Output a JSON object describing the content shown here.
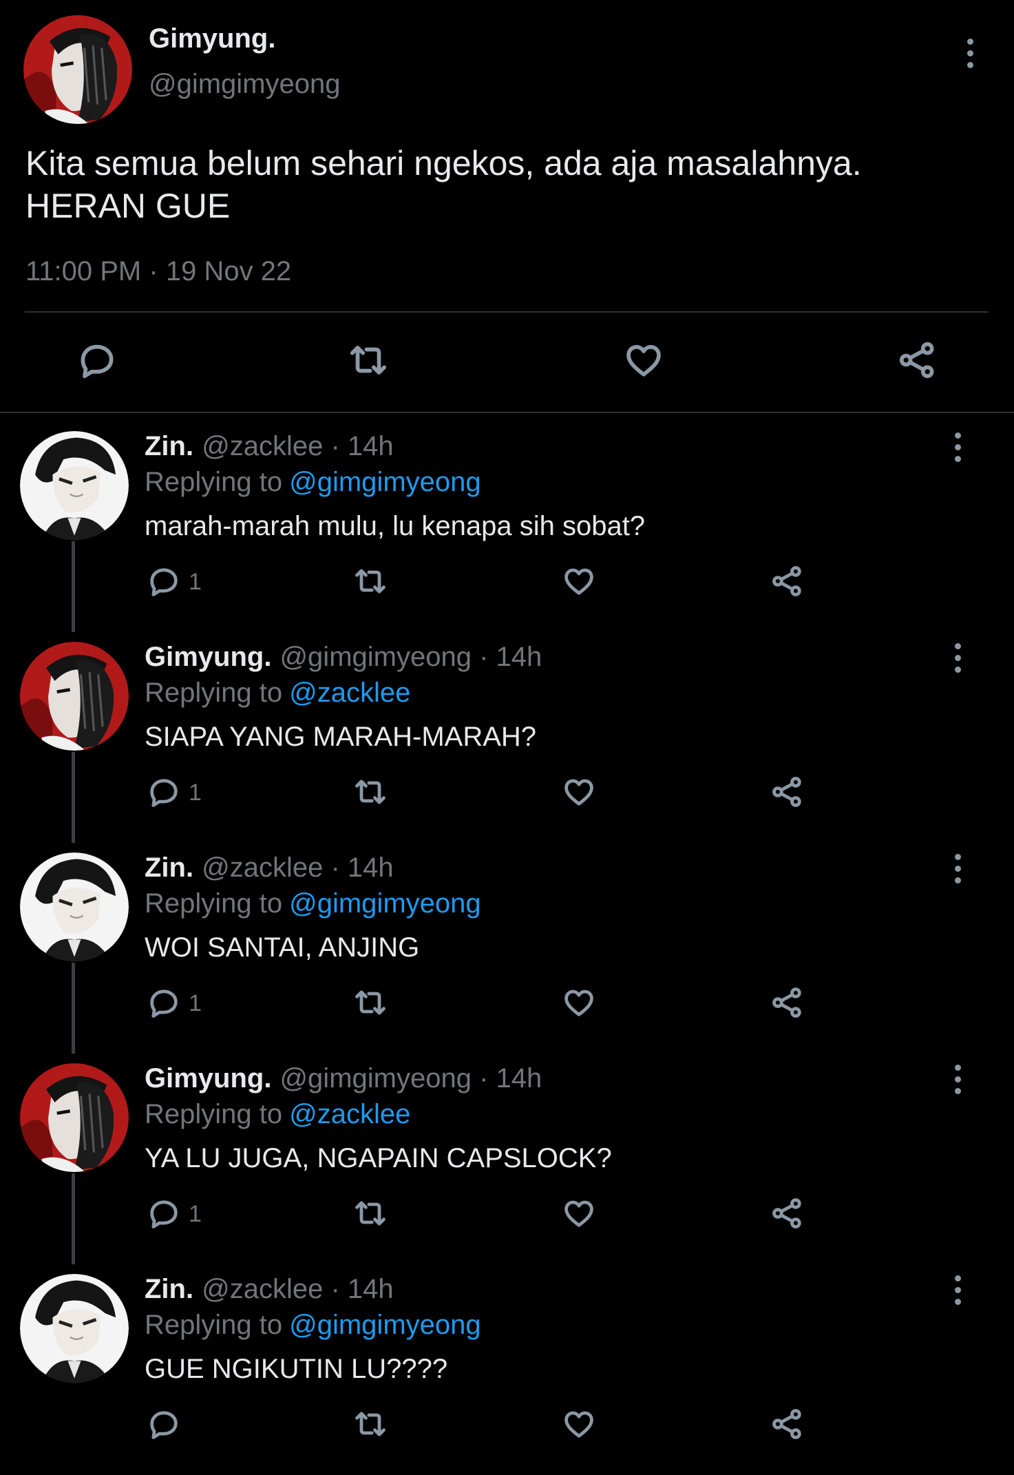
{
  "main_tweet": {
    "display_name": "Gimyung.",
    "handle": "@gimgimyeong",
    "text_line1": "Kita semua belum sehari ngekos, ada aja masalahnya.",
    "text_line2": "HERAN GUE",
    "time": "11:00 PM",
    "separator": "·",
    "date": "19 Nov 22",
    "actions": [
      "reply-icon",
      "retweet-icon",
      "like-icon",
      "share-icon"
    ]
  },
  "replies": [
    {
      "display_name": "Zin.",
      "handle": "@zacklee",
      "age": "· 14h",
      "replying_label": "Replying to",
      "replying_to": "@gimgimyeong",
      "text": "marah-marah mulu, lu kenapa sih sobat?",
      "reply_count": "1",
      "avatar": "zin"
    },
    {
      "display_name": "Gimyung.",
      "handle": "@gimgimyeong",
      "age": "· 14h",
      "replying_label": "Replying to",
      "replying_to": "@zacklee",
      "text": "SIAPA YANG MARAH-MARAH?",
      "reply_count": "1",
      "avatar": "gimyung"
    },
    {
      "display_name": "Zin.",
      "handle": "@zacklee",
      "age": "· 14h",
      "replying_label": "Replying to",
      "replying_to": "@gimgimyeong",
      "text": "WOI SANTAI, ANJING",
      "reply_count": "1",
      "avatar": "zin"
    },
    {
      "display_name": "Gimyung.",
      "handle": "@gimgimyeong",
      "age": "· 14h",
      "replying_label": "Replying to",
      "replying_to": "@zacklee",
      "text": "YA LU JUGA, NGAPAIN CAPSLOCK?",
      "reply_count": "1",
      "avatar": "gimyung"
    },
    {
      "display_name": "Zin.",
      "handle": "@zacklee",
      "age": "· 14h",
      "replying_label": "Replying to",
      "replying_to": "@gimgimyeong",
      "text": "GUE NGIKUTIN LU????",
      "reply_count": "",
      "avatar": "zin"
    }
  ],
  "colors": {
    "background": "#000000",
    "text": "#e7e9ea",
    "muted": "#71767b",
    "link": "#1d9bf0",
    "icon": "#8b98a5",
    "divider": "#2f3336"
  }
}
